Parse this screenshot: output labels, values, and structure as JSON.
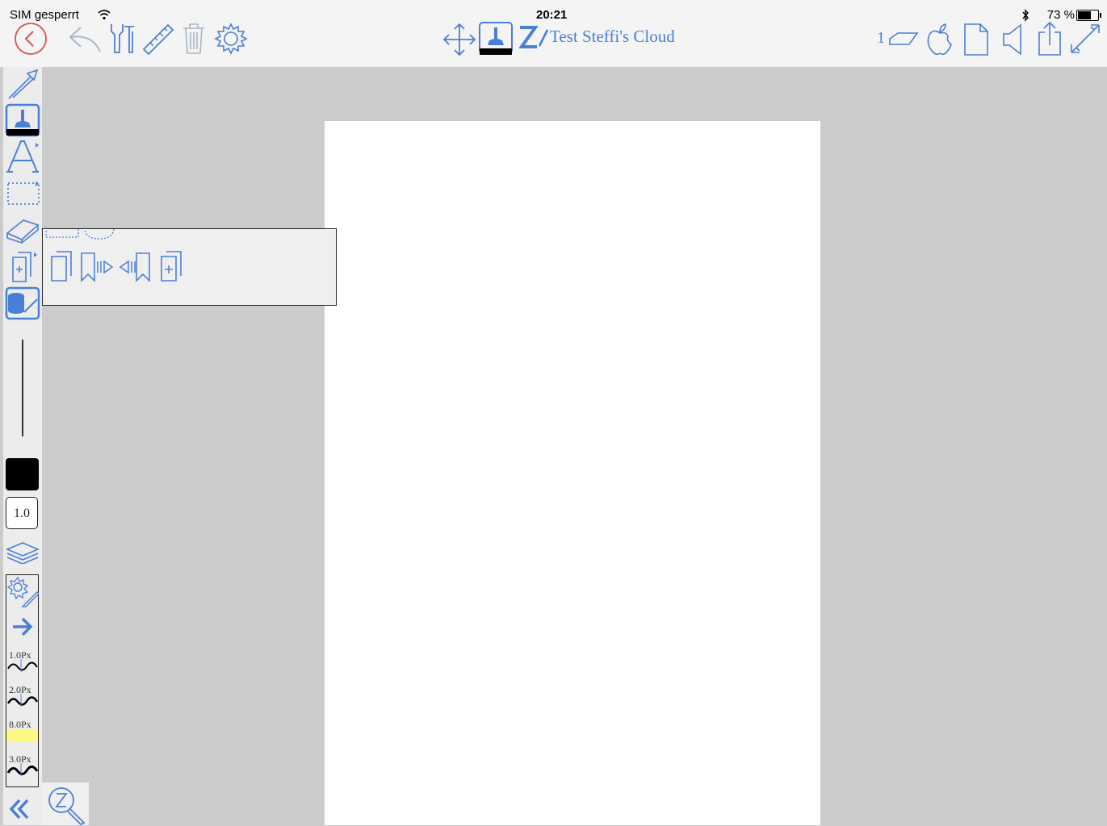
{
  "status_bar": {
    "carrier": "SIM gesperrt",
    "time": "20:21",
    "battery": "73 %",
    "battery_level": 0.73
  },
  "toolbar": {
    "document_title": "Test Steffi's Cloud",
    "page_number": "1",
    "left_icons": [
      "back-circle-icon",
      "undo-icon",
      "tools-icon",
      "ruler-icon",
      "trash-icon",
      "gear-icon"
    ],
    "center_icons": [
      "move-icon",
      "pen-tool-icon",
      "zoomnotes-logo-icon"
    ],
    "right_icons": [
      "page-shape-icon",
      "apple-icon",
      "page-icon",
      "speaker-icon",
      "share-icon",
      "fullscreen-icon"
    ]
  },
  "sidebar": {
    "tools": [
      "laser-pointer-icon",
      "pen-tool-icon",
      "text-tool-icon",
      "selection-tool-icon",
      "eraser-icon",
      "pages-icon",
      "layers-database-icon"
    ],
    "stroke_width": "1.0",
    "current_color": "#000000",
    "presets": [
      {
        "label": "1.0Px"
      },
      {
        "label": "2.0Px"
      },
      {
        "label": "8.0Px"
      },
      {
        "label": "3.0Px"
      }
    ]
  },
  "popup": {
    "icons": [
      "duplicate-page-icon",
      "bookmark-next-icon",
      "bookmark-previous-icon",
      "add-page-icon"
    ]
  },
  "colors": {
    "accent": "#4a7fd6",
    "accent_light": "#6e9fe6",
    "back_red": "#d9534f",
    "highlight": "#ffff66"
  }
}
